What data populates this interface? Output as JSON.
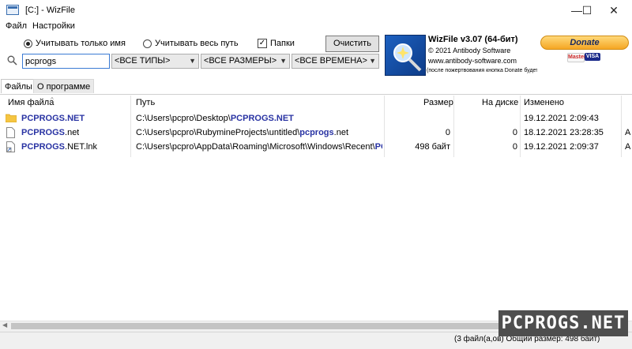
{
  "window": {
    "title": "[C:]  - WizFile",
    "minimize": "—",
    "maximize": "☐",
    "close": "✕"
  },
  "menu": [
    "Файл",
    "Настройки"
  ],
  "options": {
    "name_only": "Учитывать только имя",
    "full_path": "Учитывать весь путь",
    "folders": "Папки",
    "clear": "Очистить"
  },
  "search": {
    "value": "pcprogs",
    "types": "<ВСЕ ТИПЫ>",
    "sizes": "<ВСЕ РАЗМЕРЫ>",
    "times": "<ВСЕ ВРЕМЕНА>"
  },
  "about": {
    "title": "WizFile v3.07 (64-бит)",
    "copyright": "© 2021 Antibody Software",
    "site": "www.antibody-software.com",
    "note": "(после пожертвования кнопка Donate будет скрыта)"
  },
  "donate": {
    "label": "Donate",
    "card1": "Master",
    "card2": "VISA"
  },
  "tabs": [
    "Файлы",
    "О программе"
  ],
  "columns": {
    "name": "Имя файла",
    "path": "Путь",
    "size": "Размер",
    "disk": "На диске",
    "modified": "Изменено"
  },
  "rows": [
    {
      "icon": "folder-icon",
      "name": "PCPROGS.NET",
      "name_rest": "",
      "path_pre": "C:\\Users\\pcpro\\Desktop\\",
      "path_hl": "PCPROGS.NET",
      "path_post": "",
      "size": "",
      "disk": "",
      "modified": "19.12.2021 2:09:43",
      "extra": ""
    },
    {
      "icon": "file-icon",
      "name": "PCPROGS",
      "name_rest": ".net",
      "path_pre": "C:\\Users\\pcpro\\RubymineProjects\\untitled\\",
      "path_hl": "pcprogs",
      "path_post": ".net",
      "size": "0",
      "disk": "0",
      "modified": "18.12.2021 23:28:35",
      "extra": "A"
    },
    {
      "icon": "shortcut-file-icon",
      "name": "PCPROGS",
      "name_rest": ".NET.lnk",
      "path_pre": "C:\\Users\\pcpro\\AppData\\Roaming\\Microsoft\\Windows\\Recent\\",
      "path_hl": "PCPROGS",
      "path_post": "",
      "size": "498 байт",
      "disk": "0",
      "modified": "19.12.2021 2:09:37",
      "extra": "A"
    }
  ],
  "status": "(3 файл(а,ов)   Общий размер: 498 байт)",
  "watermark": "PCPROGS.NET"
}
